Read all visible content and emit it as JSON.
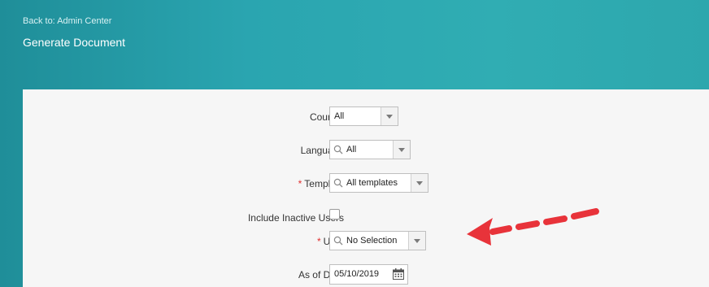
{
  "header": {
    "back_link": "Back to: Admin Center",
    "title": "Generate Document"
  },
  "form": {
    "country": {
      "label": "Country",
      "value": "All"
    },
    "language": {
      "label": "Language",
      "value": "All"
    },
    "template": {
      "label": "Template",
      "value": "All templates",
      "required_mark": "*"
    },
    "include_inactive": {
      "label": "Include Inactive Users",
      "checked": false
    },
    "user": {
      "label": "User",
      "value": "No Selection",
      "required_mark": "*"
    },
    "as_of_date": {
      "label": "As of Date",
      "value": "05/10/2019"
    }
  },
  "icons": {
    "search": "search-icon",
    "dropdown": "chevron-down-icon",
    "calendar": "calendar-icon",
    "annotation": "red-dashed-arrow"
  },
  "colors": {
    "header_teal": "#2aa5b0",
    "required": "#e03030",
    "annotation_arrow": "#e8333a"
  }
}
